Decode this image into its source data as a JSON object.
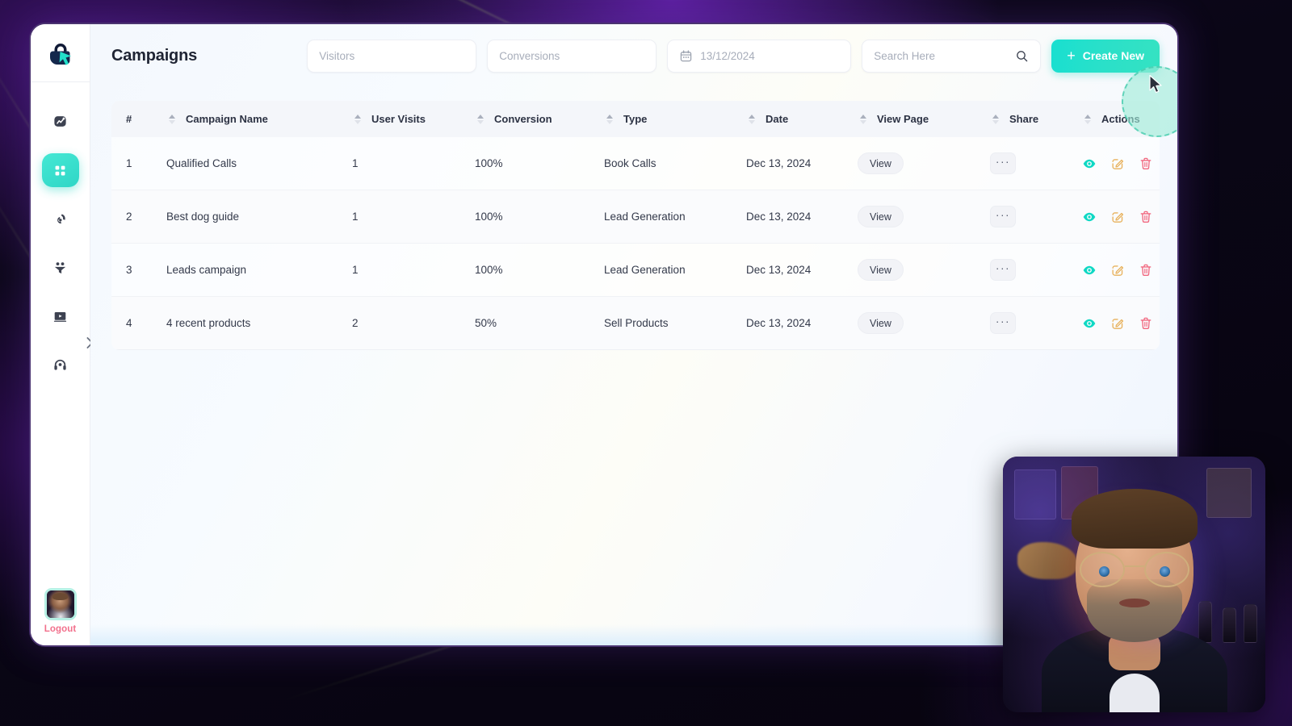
{
  "app": {
    "page_title": "Campaigns"
  },
  "sidebar": {
    "logo_icon": "lock-cursor-logo-icon",
    "items": [
      {
        "icon": "analytics-icon",
        "name": "analytics",
        "active": false
      },
      {
        "icon": "grid-icon",
        "name": "dashboard",
        "active": true
      },
      {
        "icon": "rocket-icon",
        "name": "campaigns",
        "active": false
      },
      {
        "icon": "funnel-icon",
        "name": "audience",
        "active": false
      },
      {
        "icon": "video-icon",
        "name": "media",
        "active": false
      },
      {
        "icon": "support-icon",
        "name": "support",
        "active": false
      }
    ],
    "expand_icon": "chevron-right-icon",
    "logout_label": "Logout"
  },
  "toolbar": {
    "visitors_placeholder": "Visitors",
    "conversions_placeholder": "Conversions",
    "date_value": "13/12/2024",
    "date_icon": "calendar-icon",
    "search_placeholder": "Search Here",
    "search_icon": "search-icon",
    "create_label": "Create New",
    "create_plus": "+",
    "accent_color": "#25dfcb"
  },
  "table": {
    "columns": [
      {
        "key": "num",
        "label": "#",
        "sortable": false
      },
      {
        "key": "name",
        "label": "Campaign Name",
        "sortable": true
      },
      {
        "key": "visit",
        "label": "User Visits",
        "sortable": true
      },
      {
        "key": "conv",
        "label": "Conversion",
        "sortable": true
      },
      {
        "key": "type",
        "label": "Type",
        "sortable": true
      },
      {
        "key": "date",
        "label": "Date",
        "sortable": true
      },
      {
        "key": "view",
        "label": "View Page",
        "sortable": true
      },
      {
        "key": "share",
        "label": "Share",
        "sortable": true
      },
      {
        "key": "act",
        "label": "Actions",
        "sortable": true
      }
    ],
    "view_label": "View",
    "share_label": "···",
    "action_icons": [
      "view-eye-icon",
      "edit-pencil-icon",
      "delete-trash-icon"
    ],
    "action_colors": {
      "view": "#0fd8c4",
      "edit": "#e8b15c",
      "delete": "#f1677f"
    },
    "rows": [
      {
        "num": "1",
        "name": "Qualified Calls",
        "visit": "1",
        "conv": "100%",
        "type": "Book Calls",
        "date": "Dec 13, 2024"
      },
      {
        "num": "2",
        "name": "Best dog guide",
        "visit": "1",
        "conv": "100%",
        "type": "Lead Generation",
        "date": "Dec 13, 2024"
      },
      {
        "num": "3",
        "name": "Leads campaign",
        "visit": "1",
        "conv": "100%",
        "type": "Lead Generation",
        "date": "Dec 13, 2024"
      },
      {
        "num": "4",
        "name": "4 recent products",
        "visit": "2",
        "conv": "50%",
        "type": "Sell Products",
        "date": "Dec 13, 2024"
      }
    ]
  },
  "overlays": {
    "cursor_icon": "mouse-pointer-icon",
    "click_ripple": "click-highlight",
    "webcam": "presenter-webcam"
  }
}
